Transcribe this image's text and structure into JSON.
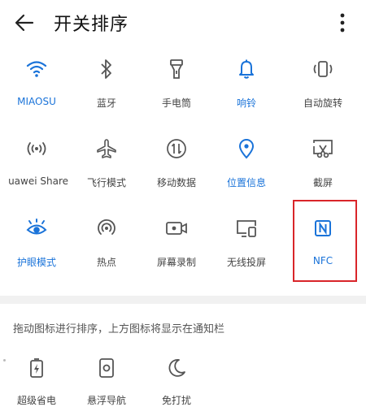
{
  "header": {
    "title": "开关排序"
  },
  "tiles": [
    {
      "label": "MIAOSU",
      "icon": "wifi-icon",
      "active": true
    },
    {
      "label": "蓝牙",
      "icon": "bluetooth-icon",
      "active": false
    },
    {
      "label": "手电筒",
      "icon": "flashlight-icon",
      "active": false
    },
    {
      "label": "响铃",
      "icon": "bell-icon",
      "active": true
    },
    {
      "label": "自动旋转",
      "icon": "auto-rotate-icon",
      "active": false
    },
    {
      "label": "uawei Share",
      "icon": "huawei-share-icon",
      "active": false
    },
    {
      "label": "飞行模式",
      "icon": "airplane-icon",
      "active": false
    },
    {
      "label": "移动数据",
      "icon": "mobile-data-icon",
      "active": false
    },
    {
      "label": "位置信息",
      "icon": "location-icon",
      "active": true
    },
    {
      "label": "截屏",
      "icon": "screenshot-icon",
      "active": false
    },
    {
      "label": "护眼模式",
      "icon": "eye-comfort-icon",
      "active": true
    },
    {
      "label": "热点",
      "icon": "hotspot-icon",
      "active": false
    },
    {
      "label": "屏幕录制",
      "icon": "screen-record-icon",
      "active": false
    },
    {
      "label": "无线投屏",
      "icon": "wireless-projection-icon",
      "active": false
    },
    {
      "label": "NFC",
      "icon": "nfc-icon",
      "active": true
    }
  ],
  "hint": "拖动图标进行排序，上方图标将显示在通知栏",
  "tray": [
    {
      "label": "超级省电",
      "icon": "power-saving-icon"
    },
    {
      "label": "悬浮导航",
      "icon": "floating-nav-icon"
    },
    {
      "label": "免打扰",
      "icon": "do-not-disturb-icon"
    }
  ],
  "colors": {
    "accent": "#1a73d9",
    "inactive": "#555555",
    "highlight": "#d9252a"
  }
}
